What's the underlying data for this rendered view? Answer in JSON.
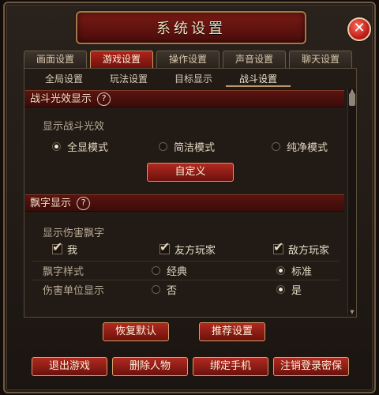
{
  "window": {
    "title": "系统设置"
  },
  "tabs": [
    {
      "label": "画面设置"
    },
    {
      "label": "游戏设置"
    },
    {
      "label": "操作设置"
    },
    {
      "label": "声音设置"
    },
    {
      "label": "聊天设置"
    }
  ],
  "active_tab_index": 1,
  "subtabs": [
    {
      "label": "全局设置"
    },
    {
      "label": "玩法设置"
    },
    {
      "label": "目标显示"
    },
    {
      "label": "战斗设置"
    }
  ],
  "active_subtab_index": 3,
  "battle_effects": {
    "header": "战斗光效显示",
    "help": "?",
    "label": "显示战斗光效",
    "options": [
      {
        "label": "全显模式",
        "selected": true
      },
      {
        "label": "简洁模式",
        "selected": false
      },
      {
        "label": "纯净模式",
        "selected": false
      }
    ],
    "custom_button": "自定义"
  },
  "floating_text": {
    "header": "飘字显示",
    "help": "?",
    "damage_label": "显示伤害飘字",
    "damage_checks": [
      {
        "label": "我",
        "checked": true
      },
      {
        "label": "友方玩家",
        "checked": true
      },
      {
        "label": "敌方玩家",
        "checked": true
      }
    ],
    "style_label": "飘字样式",
    "style_options": [
      {
        "label": "经典",
        "selected": false
      },
      {
        "label": "标准",
        "selected": true
      }
    ],
    "unit_label": "伤害单位显示",
    "unit_options": [
      {
        "label": "否",
        "selected": false
      },
      {
        "label": "是",
        "selected": true
      }
    ]
  },
  "actions": {
    "restore_default": "恢复默认",
    "recommended": "推荐设置"
  },
  "footer": {
    "exit_game": "退出游戏",
    "delete_character": "删除人物",
    "bind_phone": "绑定手机",
    "cancel_login_protection": "注销登录密保"
  },
  "colors": {
    "accent_red": "#8a1a14",
    "gold_border": "#c79a5c",
    "panel_bg": "#211a15"
  }
}
